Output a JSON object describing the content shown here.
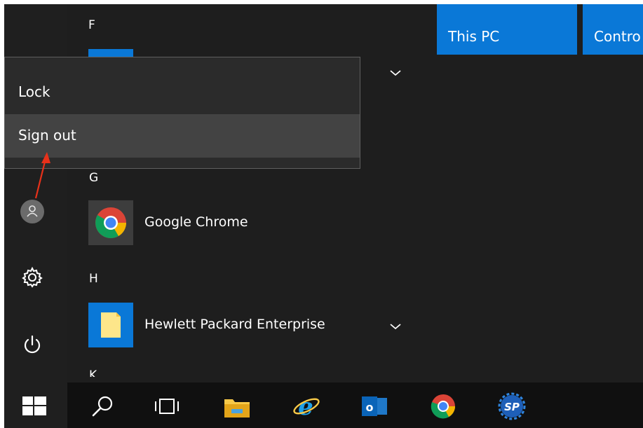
{
  "start_menu": {
    "groups": [
      {
        "letter": "F"
      },
      {
        "letter": "G"
      },
      {
        "letter": "H"
      },
      {
        "letter": "K"
      }
    ],
    "apps": [
      {
        "label": "Google Chrome"
      },
      {
        "label": "Hewlett Packard Enterprise"
      }
    ],
    "tiles": [
      {
        "label": "This PC"
      },
      {
        "label": "Contro"
      }
    ]
  },
  "account_flyout": {
    "items": [
      {
        "label": "Lock"
      },
      {
        "label": "Sign out"
      }
    ],
    "highlighted": "Sign out"
  },
  "rail": {
    "icons": [
      "user-avatar-icon",
      "settings-gear-icon",
      "power-icon"
    ]
  },
  "taskbar": {
    "icons": [
      "windows-start-icon",
      "search-icon",
      "task-view-icon",
      "file-explorer-icon",
      "internet-explorer-icon",
      "outlook-icon",
      "chrome-icon",
      "sp-app-icon"
    ]
  },
  "colors": {
    "accent": "#0a78d7",
    "annotation_arrow": "#e8311a",
    "menu_background": "#1e1e1e",
    "flyout_background": "#2b2b2b",
    "flyout_highlight": "#434343"
  }
}
